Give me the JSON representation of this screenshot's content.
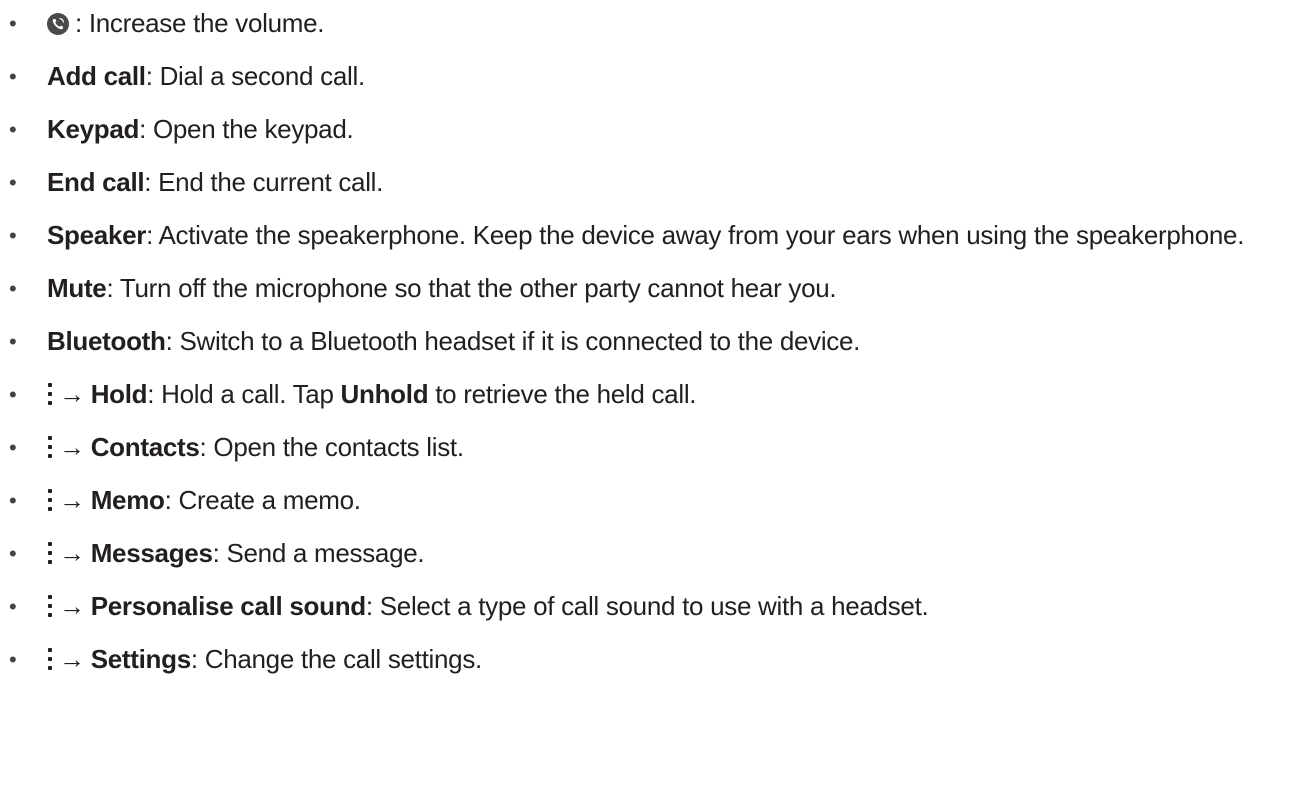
{
  "bullet": "•",
  "arrow": "→",
  "icons": {
    "volume": "volume-up-phone-icon",
    "more": "more-options-icon"
  },
  "items": [
    {
      "term": "",
      "desc": ": Increase the volume."
    },
    {
      "term": "Add call",
      "desc": ": Dial a second call."
    },
    {
      "term": "Keypad",
      "desc": ": Open the keypad."
    },
    {
      "term": "End call",
      "desc": ": End the current call."
    },
    {
      "term": "Speaker",
      "desc": ": Activate the speakerphone. Keep the device away from your ears when using the speakerphone."
    },
    {
      "term": "Mute",
      "desc": ": Turn off the microphone so that the other party cannot hear you."
    },
    {
      "term": "Bluetooth",
      "desc": ": Switch to a Bluetooth headset if it is connected to the device."
    },
    {
      "term": "Hold",
      "desc": ": Hold a call. Tap ",
      "term2": "Unhold",
      "desc2": " to retrieve the held call."
    },
    {
      "term": "Contacts",
      "desc": ": Open the contacts list."
    },
    {
      "term": "Memo",
      "desc": ": Create a memo."
    },
    {
      "term": "Messages",
      "desc": ": Send a message."
    },
    {
      "term": "Personalise call sound",
      "desc": ": Select a type of call sound to use with a headset."
    },
    {
      "term": "Settings",
      "desc": ": Change the call settings."
    }
  ]
}
